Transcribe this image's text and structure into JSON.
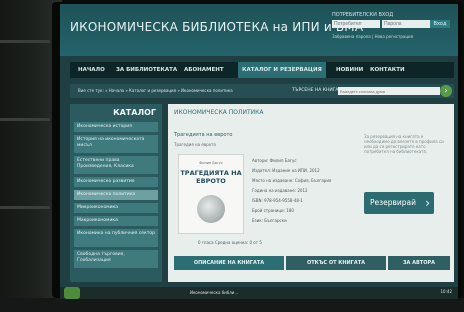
{
  "site_title": "ИКОНОМИЧЕСКА БИБЛИОТЕКА на ИПИ и БМА",
  "login": {
    "title": "ПОТРЕБИТЕЛСКИ ВХОД",
    "user_placeholder": "Потребител",
    "pass_placeholder": "Парола",
    "button": "Вход",
    "links": "Забравена парола | Нова регистрация"
  },
  "nav": [
    {
      "label": "НАЧАЛО"
    },
    {
      "label": "ЗА БИБЛИОТЕКАТА"
    },
    {
      "label": "АБОНАМЕНТ"
    },
    {
      "label": "КАТАЛОГ И РЕЗЕРВАЦИЯ",
      "active": true
    },
    {
      "label": "НОВИНИ"
    },
    {
      "label": "КОНТАКТИ"
    }
  ],
  "breadcrumb": "Вие сте тук: » Начало » Каталог и резервация » Икономическа политика",
  "search": {
    "label": "ТЪРСЕНЕ НА КНИГА",
    "placeholder": "Въведете ключова дума",
    "button": "›"
  },
  "sidebar": {
    "title": "КАТАЛОГ",
    "items": [
      {
        "label": "Икономическа история"
      },
      {
        "label": "История на икономическата мисъл"
      },
      {
        "label": "Естествени права Произведения, Класика"
      },
      {
        "label": "Икономическо развитие"
      },
      {
        "label": "Икономическа политика",
        "active": true
      },
      {
        "label": "Микроикономика"
      },
      {
        "label": "Макроикономика"
      },
      {
        "label": "Икономика на публичния сектор"
      },
      {
        "label": "Свободна търговия, Глобализация"
      }
    ]
  },
  "main": {
    "title": "ИКОНОМИЧЕСКА ПОЛИТИКА",
    "book_link": "Трагедията на еврото",
    "subtitle": "Трагедия на еврото",
    "cover_author": "Филип Багус",
    "cover_title": "ТРАГЕДИЯТА НА ЕВРОТО",
    "meta": [
      "Автори: Филип Багус",
      "Издател: Издание на ИПИ, 2012",
      "Място на издаване: София, България",
      "Година на издаване: 2012",
      "ISBN: 978-954-9558-48-1",
      "Брой страници: 180",
      "Език: Български"
    ],
    "side_note": "За резервация на книгата е необходимо да влезете в профила си или да се регистрирате като потребител на библиотеката.",
    "reserve_button": "Резервирай",
    "rating_label": "0 гласа   Средна оценка: 0 от 5",
    "tabs": [
      "ОПИСАНИЕ НА КНИГАТА",
      "ОТКЪС ОТ КНИГАТА",
      "ЗА АВТОРА"
    ]
  },
  "taskbar": {
    "item1": "Икономическа библи...",
    "clock": "10:42"
  }
}
